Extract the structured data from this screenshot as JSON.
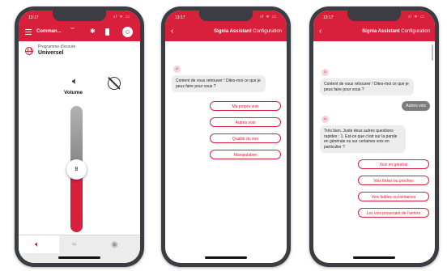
{
  "phone1": {
    "time": "13:17",
    "header_title": "Comman...",
    "program_label": "Programme d'écoute",
    "program_value": "Universel",
    "volume_label": "Volume",
    "volume_value": "8",
    "volume_level_fraction": 0.5
  },
  "phone2": {
    "time": "13:17",
    "title": "Signia Assistant",
    "subtitle": "Configuration",
    "bot_message": "Content de vous retrouver ! Dites-moi ce que je peux faire pour vous ?",
    "options": [
      "Ma propre voix",
      "Autres voix",
      "Qualité du son",
      "Manipulation"
    ]
  },
  "phone3": {
    "time": "13:17",
    "title": "Signia Assistant",
    "subtitle": "Configuration",
    "bot_message_1": "Content de vous retrouver ! Dites-moi ce que je peux faire pour vous ?",
    "user_reply": "Autres voix",
    "bot_message_2": "Très bien. Juste deux autres questions rapides : 1. Est-ce que c'est sur la parole en générale ou sur certaines voix en particulier ?",
    "options": [
      "Voix en général",
      "Voix fortes ou proches",
      "Voix faibles ou lointaines",
      "Les voix provenant de l'arrière"
    ]
  },
  "colors": {
    "brand_red": "#d8203d",
    "bubble_grey": "#ededed"
  },
  "icons": {
    "menu": "hamburger-menu-icon",
    "chevron": "chevron-down-icon",
    "bluetooth": "bluetooth-icon",
    "battery": "battery-icon",
    "avatar": "signia-avatar-icon",
    "program": "globe-icon",
    "speaker": "speaker-icon",
    "mute": "mute-icon",
    "back": "back-arrow-icon",
    "bot": "signia-bot-icon"
  }
}
